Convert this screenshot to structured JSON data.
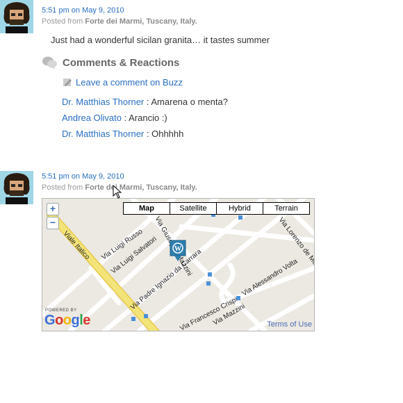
{
  "colors": {
    "link": "#2a6fc0",
    "muted": "#9a9a9a",
    "avatar_bg": "#9fd6e6",
    "map_bg": "#ece9e2",
    "road_major": "#f3e47a"
  },
  "post1": {
    "time": "5:51 pm on May 9, 2010",
    "posted_from_prefix": "Posted from",
    "location": "Forte dei Marmi, Tuscany, Italy.",
    "text": "Just had a wonderful sicilan granita… it tastes summer",
    "comments_heading": "Comments & Reactions",
    "leave_comment": "Leave a comment on Buzz",
    "comments": [
      {
        "author": "Dr. Matthias Thorner",
        "separator": " : ",
        "text": "Amarena o menta?"
      },
      {
        "author": "Andrea Olivato",
        "separator": " : ",
        "text": "Arancio :)"
      },
      {
        "author": "Dr. Matthias Thorner",
        "separator": " : ",
        "text": "Ohhhhh"
      }
    ]
  },
  "post2": {
    "time": "5:51 pm on May 9, 2010",
    "posted_from_prefix": "Posted from",
    "location": "Forte dei Marmi, Tuscany, Italy."
  },
  "map": {
    "zoom_in": "+",
    "zoom_out": "−",
    "types": [
      "Map",
      "Satellite",
      "Hybrid",
      "Terrain"
    ],
    "selected_type": "Map",
    "streets": [
      "Viale Italico",
      "Via Luigi Russo",
      "Via Luigi Salvatori",
      "Via Padre Ignazio da Carrara",
      "Via Giuseppe Mazzini",
      "Via Alessandro Volta",
      "Via Lorenzo de Medici",
      "Via Francesco Crispi",
      "Via Mazzini"
    ],
    "powered_by": "POWERED BY",
    "google": "Google",
    "terms": "Terms of Use"
  }
}
